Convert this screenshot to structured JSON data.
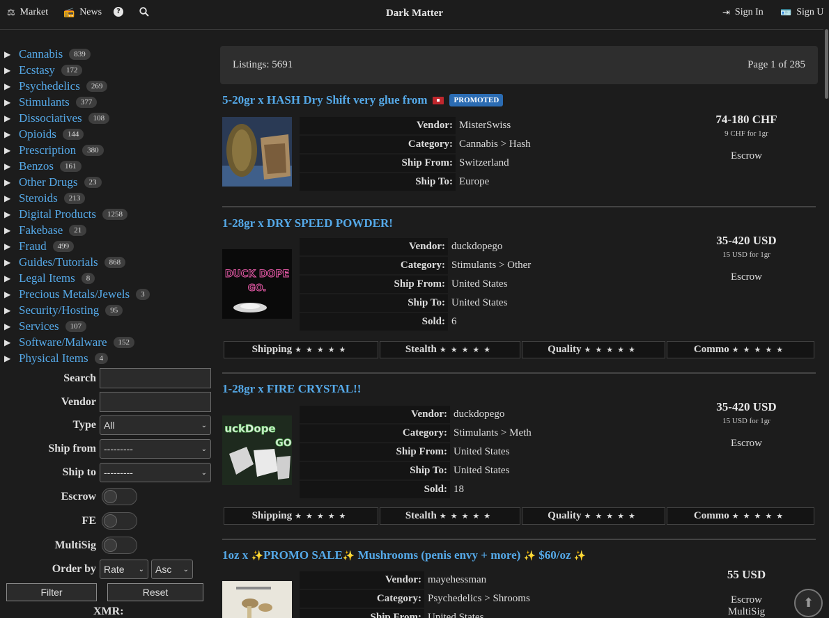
{
  "nav": {
    "market": "Market",
    "news": "News",
    "brand": "Dark Matter",
    "sign_in": "Sign In",
    "sign_up": "Sign Up"
  },
  "categories": [
    {
      "name": "Cannabis",
      "count": "839"
    },
    {
      "name": "Ecstasy",
      "count": "172"
    },
    {
      "name": "Psychedelics",
      "count": "269"
    },
    {
      "name": "Stimulants",
      "count": "377"
    },
    {
      "name": "Dissociatives",
      "count": "108"
    },
    {
      "name": "Opioids",
      "count": "144"
    },
    {
      "name": "Prescription",
      "count": "380"
    },
    {
      "name": "Benzos",
      "count": "161"
    },
    {
      "name": "Other Drugs",
      "count": "23"
    },
    {
      "name": "Steroids",
      "count": "213"
    },
    {
      "name": "Digital Products",
      "count": "1258"
    },
    {
      "name": "Fakebase",
      "count": "21"
    },
    {
      "name": "Fraud",
      "count": "499"
    },
    {
      "name": "Guides/Tutorials",
      "count": "868"
    },
    {
      "name": "Legal Items",
      "count": "8"
    },
    {
      "name": "Precious Metals/Jewels",
      "count": "3"
    },
    {
      "name": "Security/Hosting",
      "count": "95"
    },
    {
      "name": "Services",
      "count": "107"
    },
    {
      "name": "Software/Malware",
      "count": "152"
    },
    {
      "name": "Physical Items",
      "count": "4"
    }
  ],
  "filters": {
    "search_label": "Search",
    "vendor_label": "Vendor",
    "type_label": "Type",
    "type_value": "All",
    "ship_from_label": "Ship from",
    "ship_from_value": "---------",
    "ship_to_label": "Ship to",
    "ship_to_value": "---------",
    "escrow_label": "Escrow",
    "fe_label": "FE",
    "multisig_label": "MultiSig",
    "order_by_label": "Order by",
    "order_by_value": "Rate",
    "order_dir_value": "Asc",
    "filter_button": "Filter",
    "reset_button": "Reset",
    "xmr_label": "XMR:"
  },
  "listing_header": {
    "listings": "Listings: 5691",
    "page": "Page 1 of 285"
  },
  "labels": {
    "vendor": "Vendor:",
    "category": "Category:",
    "ship_from": "Ship From:",
    "ship_to": "Ship To:",
    "sold": "Sold:",
    "shipping": "Shipping",
    "stealth": "Stealth",
    "quality": "Quality",
    "commo": "Commo",
    "promoted": "PROMOTED"
  },
  "listings": [
    {
      "title": "5-20gr x HASH Dry Shift very glue from",
      "vendor": "MisterSwiss",
      "category": "Cannabis > Hash",
      "ship_from": "Switzerland",
      "ship_to": "Europe",
      "price": "74-180 CHF",
      "unit": "9 CHF for 1gr",
      "escrow": "Escrow"
    },
    {
      "title": "1-28gr x DRY SPEED POWDER!",
      "vendor": "duckdopego",
      "category": "Stimulants > Other",
      "ship_from": "United States",
      "ship_to": "United States",
      "sold": "6",
      "price": "35-420 USD",
      "unit": "15 USD for 1gr",
      "escrow": "Escrow",
      "thumb_text_1": "DUCK DOPE",
      "thumb_text_2": "GO."
    },
    {
      "title": "1-28gr x FIRE CRYSTAL!!",
      "vendor": "duckdopego",
      "category": "Stimulants > Meth",
      "ship_from": "United States",
      "ship_to": "United States",
      "sold": "18",
      "price": "35-420 USD",
      "unit": "15 USD for 1gr",
      "escrow": "Escrow",
      "thumb_text_1": "uckDope",
      "thumb_text_2": "GO"
    },
    {
      "title_pre": "1oz x",
      "title_mid": "PROMO SALE",
      "title_post": "Mushrooms (penis envy + more)",
      "title_price": "$60/oz",
      "vendor": "mayehessman",
      "category": "Psychedelics > Shrooms",
      "ship_from": "United States",
      "price": "55 USD",
      "escrow": "Escrow",
      "multisig": "MultiSig"
    }
  ]
}
